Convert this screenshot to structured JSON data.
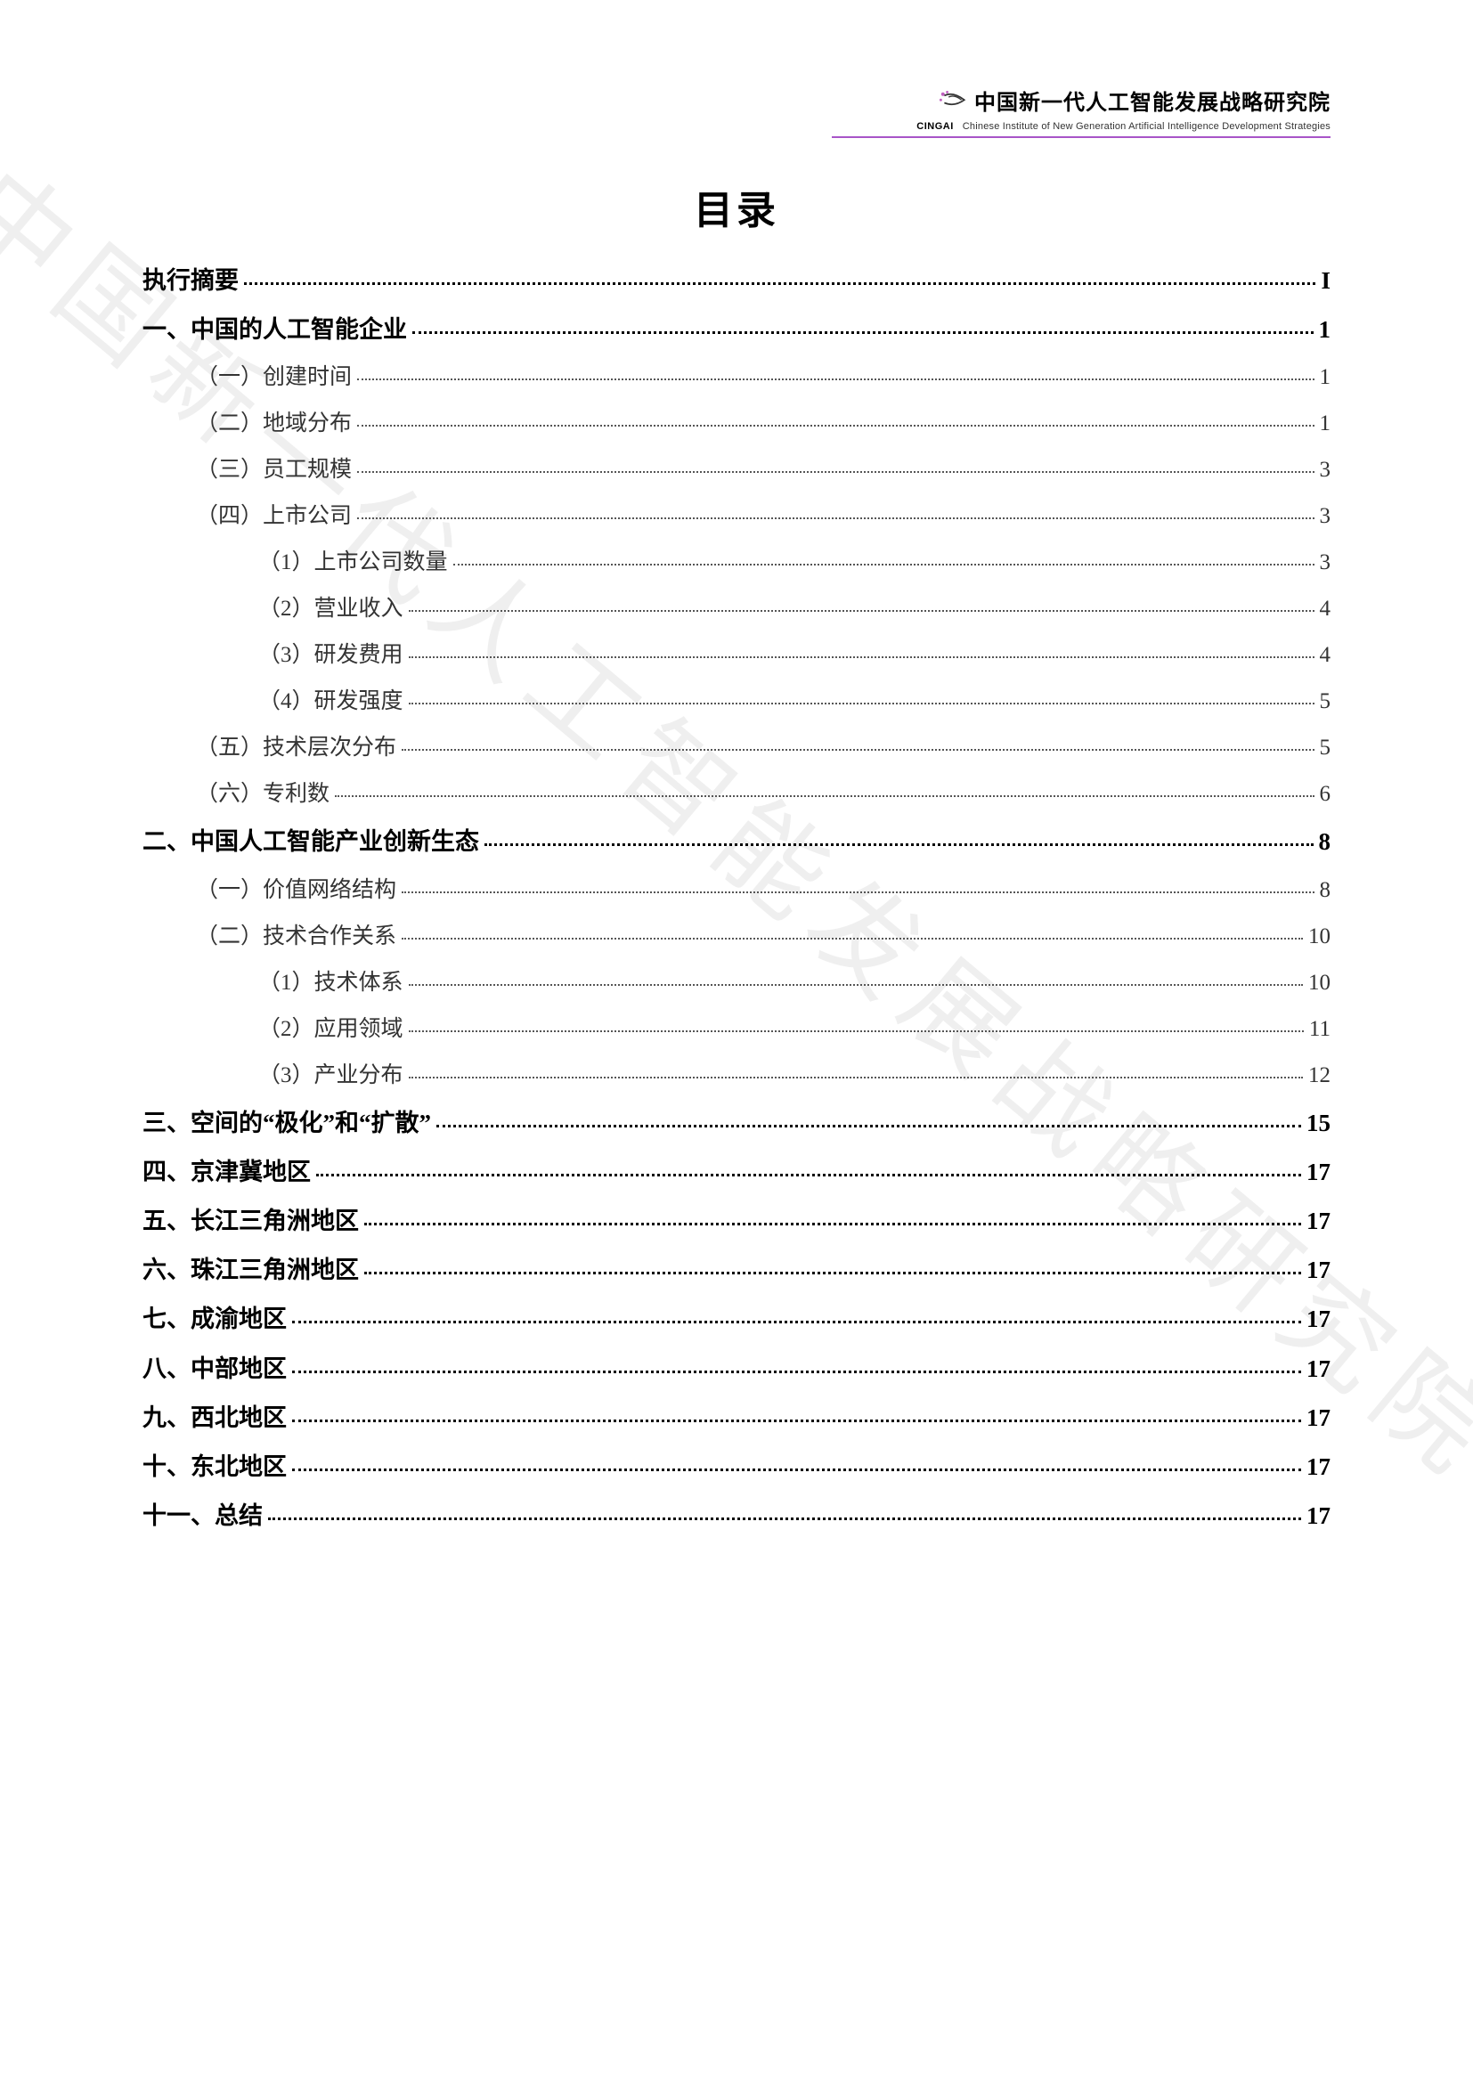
{
  "header": {
    "org_cn": "中国新一代人工智能发展战略研究院",
    "org_acronym": "CINGAI",
    "org_en": "Chinese Institute of New Generation Artificial Intelligence Development Strategies"
  },
  "title": "目录",
  "watermark": "中国新一代人工智能发展战略研究院",
  "toc": [
    {
      "level": 0,
      "label": "执行摘要",
      "page": "I"
    },
    {
      "level": 0,
      "label": "一、中国的人工智能企业",
      "page": "1"
    },
    {
      "level": 1,
      "label": "（一）创建时间",
      "page": "1"
    },
    {
      "level": 1,
      "label": "（二）地域分布",
      "page": "1"
    },
    {
      "level": 1,
      "label": "（三）员工规模",
      "page": "3"
    },
    {
      "level": 1,
      "label": "（四）上市公司",
      "page": "3"
    },
    {
      "level": 2,
      "label": "（1）上市公司数量",
      "page": "3"
    },
    {
      "level": 2,
      "label": "（2）营业收入",
      "page": "4"
    },
    {
      "level": 2,
      "label": "（3）研发费用",
      "page": "4"
    },
    {
      "level": 2,
      "label": "（4）研发强度",
      "page": "5"
    },
    {
      "level": 1,
      "label": "（五）技术层次分布",
      "page": "5"
    },
    {
      "level": 1,
      "label": "（六）专利数",
      "page": "6"
    },
    {
      "level": 0,
      "label": "二、中国人工智能产业创新生态",
      "page": "8"
    },
    {
      "level": 1,
      "label": "（一）价值网络结构",
      "page": "8"
    },
    {
      "level": 1,
      "label": "（二）技术合作关系",
      "page": "10"
    },
    {
      "level": 2,
      "label": "（1）技术体系",
      "page": "10"
    },
    {
      "level": 2,
      "label": "（2）应用领域",
      "page": "11"
    },
    {
      "level": 2,
      "label": "（3）产业分布",
      "page": "12"
    },
    {
      "level": 0,
      "label": "三、空间的“极化”和“扩散”",
      "page": "15"
    },
    {
      "level": 0,
      "label": "四、京津冀地区",
      "page": "17"
    },
    {
      "level": 0,
      "label": "五、长江三角洲地区",
      "page": "17"
    },
    {
      "level": 0,
      "label": "六、珠江三角洲地区",
      "page": "17"
    },
    {
      "level": 0,
      "label": "七、成渝地区",
      "page": "17"
    },
    {
      "level": 0,
      "label": "八、中部地区",
      "page": "17"
    },
    {
      "level": 0,
      "label": "九、西北地区",
      "page": "17"
    },
    {
      "level": 0,
      "label": "十、东北地区",
      "page": "17"
    },
    {
      "level": 0,
      "label": "十一、总结",
      "page": "17"
    }
  ]
}
